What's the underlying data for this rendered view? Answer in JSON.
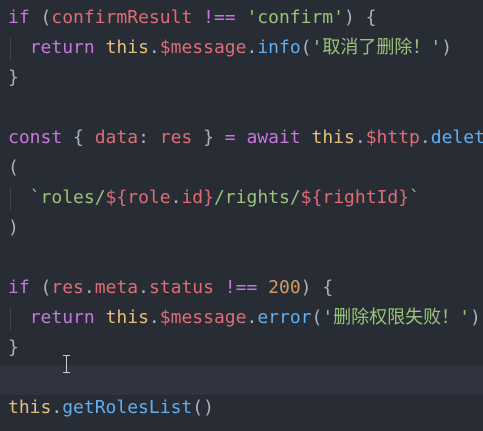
{
  "editor": {
    "lines": [
      [
        {
          "t": "if",
          "c": "kw"
        },
        {
          "t": " ",
          "c": "plain"
        },
        {
          "t": "(",
          "c": "punc"
        },
        {
          "t": "confirmResult",
          "c": "var"
        },
        {
          "t": " !== ",
          "c": "kw"
        },
        {
          "t": "'confirm'",
          "c": "str"
        },
        {
          "t": ")",
          "c": "punc"
        },
        {
          "t": " {",
          "c": "punc"
        }
      ],
      [
        {
          "t": "  ",
          "c": "plain"
        },
        {
          "t": "return",
          "c": "kw"
        },
        {
          "t": " ",
          "c": "plain"
        },
        {
          "t": "this",
          "c": "this"
        },
        {
          "t": ".",
          "c": "punc"
        },
        {
          "t": "$message",
          "c": "dollar"
        },
        {
          "t": ".",
          "c": "punc"
        },
        {
          "t": "info",
          "c": "fn"
        },
        {
          "t": "(",
          "c": "punc"
        },
        {
          "t": "'取消了删除！'",
          "c": "str"
        },
        {
          "t": ")",
          "c": "punc"
        }
      ],
      [
        {
          "t": "}",
          "c": "punc"
        }
      ],
      [],
      [
        {
          "t": "const",
          "c": "kw"
        },
        {
          "t": " { ",
          "c": "punc"
        },
        {
          "t": "data",
          "c": "var"
        },
        {
          "t": ": ",
          "c": "punc"
        },
        {
          "t": "res",
          "c": "var"
        },
        {
          "t": " } ",
          "c": "punc"
        },
        {
          "t": "=",
          "c": "kw"
        },
        {
          "t": " ",
          "c": "plain"
        },
        {
          "t": "await",
          "c": "kw"
        },
        {
          "t": " ",
          "c": "plain"
        },
        {
          "t": "this",
          "c": "this"
        },
        {
          "t": ".",
          "c": "punc"
        },
        {
          "t": "$http",
          "c": "dollar"
        },
        {
          "t": ".",
          "c": "punc"
        },
        {
          "t": "delete",
          "c": "fn"
        }
      ],
      [
        {
          "t": "(",
          "c": "punc"
        }
      ],
      [
        {
          "t": "  ",
          "c": "plain"
        },
        {
          "t": "`roles/",
          "c": "str"
        },
        {
          "t": "${",
          "c": "kw2"
        },
        {
          "t": "role",
          "c": "var"
        },
        {
          "t": ".",
          "c": "punc"
        },
        {
          "t": "id",
          "c": "var"
        },
        {
          "t": "}",
          "c": "kw2"
        },
        {
          "t": "/rights/",
          "c": "str"
        },
        {
          "t": "${",
          "c": "kw2"
        },
        {
          "t": "rightId",
          "c": "var"
        },
        {
          "t": "}",
          "c": "kw2"
        },
        {
          "t": "`",
          "c": "str"
        }
      ],
      [
        {
          "t": ")",
          "c": "punc"
        }
      ],
      [],
      [
        {
          "t": "if",
          "c": "kw"
        },
        {
          "t": " ",
          "c": "plain"
        },
        {
          "t": "(",
          "c": "punc"
        },
        {
          "t": "res",
          "c": "var"
        },
        {
          "t": ".",
          "c": "punc"
        },
        {
          "t": "meta",
          "c": "var"
        },
        {
          "t": ".",
          "c": "punc"
        },
        {
          "t": "status",
          "c": "var"
        },
        {
          "t": " !== ",
          "c": "kw"
        },
        {
          "t": "200",
          "c": "num"
        },
        {
          "t": ")",
          "c": "punc"
        },
        {
          "t": " {",
          "c": "punc"
        }
      ],
      [
        {
          "t": "  ",
          "c": "plain"
        },
        {
          "t": "return",
          "c": "kw"
        },
        {
          "t": " ",
          "c": "plain"
        },
        {
          "t": "this",
          "c": "this"
        },
        {
          "t": ".",
          "c": "punc"
        },
        {
          "t": "$message",
          "c": "dollar"
        },
        {
          "t": ".",
          "c": "punc"
        },
        {
          "t": "error",
          "c": "fn"
        },
        {
          "t": "(",
          "c": "punc"
        },
        {
          "t": "'删除权限失败！'",
          "c": "str"
        },
        {
          "t": ")",
          "c": "punc"
        }
      ],
      [
        {
          "t": "}",
          "c": "punc"
        }
      ],
      [],
      [
        {
          "t": "this",
          "c": "this"
        },
        {
          "t": ".",
          "c": "punc"
        },
        {
          "t": "getRolesList",
          "c": "fn"
        },
        {
          "t": "()",
          "c": "punc"
        }
      ]
    ]
  }
}
